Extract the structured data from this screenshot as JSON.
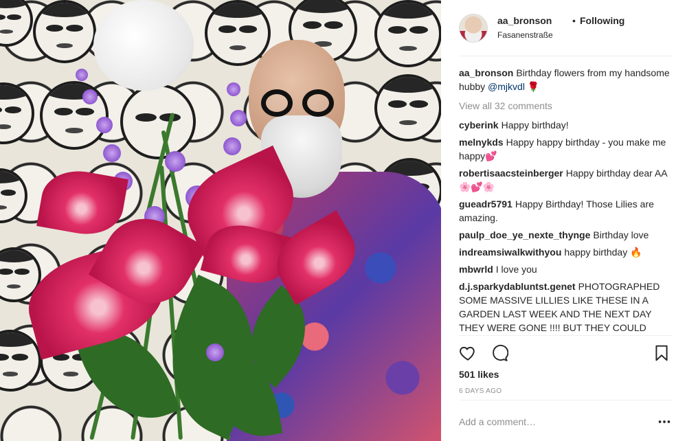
{
  "post": {
    "username": "aa_bronson",
    "separator": "•",
    "follow_status": "Following",
    "location": "Fasanenstraße",
    "caption": {
      "username": "aa_bronson",
      "text": "Birthday flowers from my handsome hubby",
      "mention": "@mjkvdl",
      "emoji": "🌹"
    },
    "view_all_label": "View all 32 comments",
    "comments": [
      {
        "username": "cyberink",
        "text": "Happy birthday!"
      },
      {
        "username": "melnykds",
        "text": "Happy happy birthday - you make me happy💕"
      },
      {
        "username": "robertisaacsteinberger",
        "text": "Happy birthday dear AA 🌸💕🌸"
      },
      {
        "username": "gueadr5791",
        "text": "Happy Birthday! Those Lilies are amazing."
      },
      {
        "username": "paulp_doe_ye_nexte_thynge",
        "text": "Birthday love"
      },
      {
        "username": "indreamsiwalkwithyou",
        "text": "happy birthday 🔥"
      },
      {
        "username": "mbwrld",
        "text": "I love you"
      },
      {
        "username": "d.j.sparkydabluntst.genet",
        "text": "PHOTOGRAPHED SOME MASSIVE LILLIES LIKE THESE IN A GARDEN LAST WEEK AND THE NEXT DAY THEY WERE GONE !!!! BUT THEY COULD"
      }
    ],
    "likes_label": "501 likes",
    "age_label": "6 DAYS AGO",
    "add_comment_placeholder": "Add a comment…",
    "icons": {
      "like": "heart-icon",
      "comment": "comment-bubble-icon",
      "save": "bookmark-icon",
      "more": "more-options-icon"
    }
  },
  "colors": {
    "text": "#262626",
    "muted": "#8e8e8e",
    "mention": "#003569",
    "divider": "#efefef"
  }
}
